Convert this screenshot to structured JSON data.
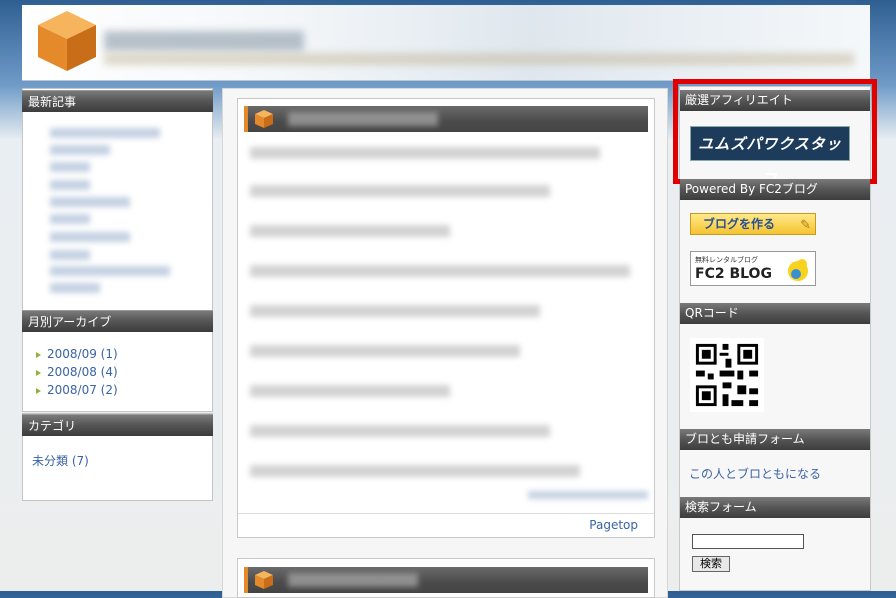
{
  "sidebar_left": {
    "recent_title": "最新記事",
    "archive_title": "月別アーカイブ",
    "archives": [
      {
        "label": "2008/09 (1)"
      },
      {
        "label": "2008/08 (4)"
      },
      {
        "label": "2008/07 (2)"
      }
    ],
    "category_title": "カテゴリ",
    "categories": [
      {
        "label": "未分類 (7)"
      }
    ]
  },
  "main": {
    "pagetop_label": "Pagetop"
  },
  "sidebar_right": {
    "affiliate_title": "厳選アフィリエイト",
    "affiliate_banner_text": "ユムズパワクスタッフ",
    "powered_title": "Powered By FC2ブログ",
    "blog_button_label": "ブログを作る",
    "fc2_banner_small": "無料レンタルブログ",
    "fc2_banner_big": "FC2 BLOG",
    "qr_title": "QRコード",
    "profile_title": "ブロとも申請フォーム",
    "profile_link": "この人とブロともになる",
    "search_title": "検索フォーム",
    "search_button": "検索"
  },
  "colors": {
    "accent_orange": "#e58a2a",
    "link_blue": "#3a63a5",
    "highlight_red": "#e10000"
  }
}
